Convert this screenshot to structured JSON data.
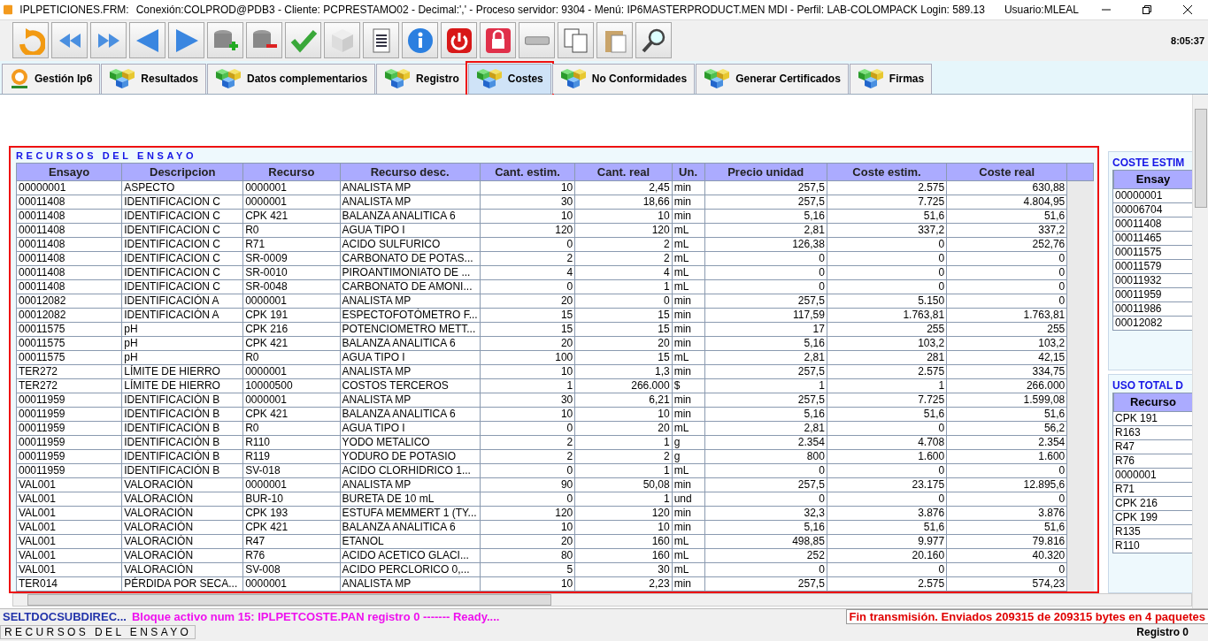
{
  "window": {
    "title": "IPLPETICIONES.FRM:",
    "info": "Conexión:COLPROD@PDB3 - Cliente: PCPRESTAMO02 - Decimal:',' - Proceso servidor: 9304 - Menú: IP6MASTERPRODUCT.MEN MDI - Perfil: LAB-COLOMPACK Login: 589.13",
    "user": "Usuario:MLEAL"
  },
  "toolbar": {
    "buttons": [
      {
        "kind": "refresh"
      },
      {
        "kind": "rewind"
      },
      {
        "kind": "forward"
      },
      {
        "kind": "prev"
      },
      {
        "kind": "next"
      },
      {
        "kind": "db-add"
      },
      {
        "kind": "db-remove"
      },
      {
        "kind": "check"
      },
      {
        "kind": "cube"
      },
      {
        "kind": "document"
      },
      {
        "kind": "info"
      },
      {
        "kind": "power"
      },
      {
        "kind": "lock"
      },
      {
        "kind": "bar"
      },
      {
        "kind": "copy"
      },
      {
        "kind": "paste"
      },
      {
        "kind": "search"
      }
    ],
    "clock": "8:05:37"
  },
  "tabs": [
    {
      "label": "Gestión Ip6",
      "kind": "logo",
      "selected": false,
      "highlighted": false
    },
    {
      "label": "Resultados",
      "kind": "cubes",
      "selected": false,
      "highlighted": false
    },
    {
      "label": "Datos complementarios",
      "kind": "cubes",
      "selected": false,
      "highlighted": false
    },
    {
      "label": "Registro",
      "kind": "cubes",
      "selected": false,
      "highlighted": false
    },
    {
      "label": "Costes",
      "kind": "cubes",
      "selected": true,
      "highlighted": true
    },
    {
      "label": "No Conformidades",
      "kind": "cubes",
      "selected": false,
      "highlighted": false
    },
    {
      "label": "Generar Certificados",
      "kind": "cubes",
      "selected": false,
      "highlighted": false
    },
    {
      "label": "Firmas",
      "kind": "cubes",
      "selected": false,
      "highlighted": false
    }
  ],
  "resources_panel": {
    "title": "RECURSOS DEL ENSAYO",
    "highlighted": true,
    "columns": [
      {
        "label": "Ensayo",
        "kind": "text"
      },
      {
        "label": "Descripcion",
        "kind": "text"
      },
      {
        "label": "Recurso",
        "kind": "text"
      },
      {
        "label": "Recurso desc.",
        "kind": "text"
      },
      {
        "label": "Cant. estim.",
        "kind": "number"
      },
      {
        "label": "Cant. real",
        "kind": "number"
      },
      {
        "label": "Un.",
        "kind": "text"
      },
      {
        "label": "Precio unidad",
        "kind": "number"
      },
      {
        "label": "Coste estim.",
        "kind": "number"
      },
      {
        "label": "Coste real",
        "kind": "number"
      }
    ],
    "rows": [
      [
        "00000001",
        "ASPECTO",
        "0000001",
        "ANALISTA MP",
        "10",
        "2,45",
        "min",
        "257,5",
        "2.575",
        "630,88"
      ],
      [
        "00011408",
        "IDENTIFICACION C",
        "0000001",
        "ANALISTA MP",
        "30",
        "18,66",
        "min",
        "257,5",
        "7.725",
        "4.804,95"
      ],
      [
        "00011408",
        "IDENTIFICACION C",
        "CPK 421",
        "BALANZA ANALITICA 6",
        "10",
        "10",
        "min",
        "5,16",
        "51,6",
        "51,6"
      ],
      [
        "00011408",
        "IDENTIFICACION C",
        "R0",
        "AGUA TIPO I",
        "120",
        "120",
        "mL",
        "2,81",
        "337,2",
        "337,2"
      ],
      [
        "00011408",
        "IDENTIFICACION C",
        "R71",
        "ACIDO SULFURICO",
        "0",
        "2",
        "mL",
        "126,38",
        "0",
        "252,76"
      ],
      [
        "00011408",
        "IDENTIFICACION C",
        "SR-0009",
        "CARBONATO DE POTAS...",
        "2",
        "2",
        "mL",
        "0",
        "0",
        "0"
      ],
      [
        "00011408",
        "IDENTIFICACION C",
        "SR-0010",
        "PIROANTIMONIATO DE ...",
        "4",
        "4",
        "mL",
        "0",
        "0",
        "0"
      ],
      [
        "00011408",
        "IDENTIFICACION C",
        "SR-0048",
        "CARBONATO DE AMONI...",
        "0",
        "1",
        "mL",
        "0",
        "0",
        "0"
      ],
      [
        "00012082",
        "IDENTIFICACIÓN A",
        "0000001",
        "ANALISTA MP",
        "20",
        "0",
        "min",
        "257,5",
        "5.150",
        "0"
      ],
      [
        "00012082",
        "IDENTIFICACIÓN A",
        "CPK 191",
        "ESPECTOFOTÓMETRO F...",
        "15",
        "15",
        "min",
        "117,59",
        "1.763,81",
        "1.763,81"
      ],
      [
        "00011575",
        "pH",
        "CPK 216",
        "POTENCIOMETRO METT...",
        "15",
        "15",
        "min",
        "17",
        "255",
        "255"
      ],
      [
        "00011575",
        "pH",
        "CPK 421",
        "BALANZA ANALITICA 6",
        "20",
        "20",
        "min",
        "5,16",
        "103,2",
        "103,2"
      ],
      [
        "00011575",
        "pH",
        "R0",
        "AGUA TIPO I",
        "100",
        "15",
        "mL",
        "2,81",
        "281",
        "42,15"
      ],
      [
        "TER272",
        "LÍMITE DE HIERRO",
        "0000001",
        "ANALISTA MP",
        "10",
        "1,3",
        "min",
        "257,5",
        "2.575",
        "334,75"
      ],
      [
        "TER272",
        "LÍMITE DE HIERRO",
        "10000500",
        "COSTOS TERCEROS",
        "1",
        "266.000",
        "$",
        "1",
        "1",
        "266.000"
      ],
      [
        "00011959",
        "IDENTIFICACIÓN B",
        "0000001",
        "ANALISTA MP",
        "30",
        "6,21",
        "min",
        "257,5",
        "7.725",
        "1.599,08"
      ],
      [
        "00011959",
        "IDENTIFICACIÓN B",
        "CPK 421",
        "BALANZA ANALITICA 6",
        "10",
        "10",
        "min",
        "5,16",
        "51,6",
        "51,6"
      ],
      [
        "00011959",
        "IDENTIFICACIÓN B",
        "R0",
        "AGUA TIPO I",
        "0",
        "20",
        "mL",
        "2,81",
        "0",
        "56,2"
      ],
      [
        "00011959",
        "IDENTIFICACIÓN B",
        "R110",
        "YODO METALICO",
        "2",
        "1",
        "g",
        "2.354",
        "4.708",
        "2.354"
      ],
      [
        "00011959",
        "IDENTIFICACIÓN B",
        "R119",
        "YODURO DE POTASIO",
        "2",
        "2",
        "g",
        "800",
        "1.600",
        "1.600"
      ],
      [
        "00011959",
        "IDENTIFICACIÓN B",
        "SV-018",
        "ACIDO CLORHIDRICO 1...",
        "0",
        "1",
        "mL",
        "0",
        "0",
        "0"
      ],
      [
        "VAL001",
        "VALORACIÓN",
        "0000001",
        "ANALISTA MP",
        "90",
        "50,08",
        "min",
        "257,5",
        "23.175",
        "12.895,6"
      ],
      [
        "VAL001",
        "VALORACIÓN",
        "BUR-10",
        "BURETA DE 10 mL",
        "0",
        "1",
        "und",
        "0",
        "0",
        "0"
      ],
      [
        "VAL001",
        "VALORACIÓN",
        "CPK 193",
        "ESTUFA MEMMERT 1 (TY...",
        "120",
        "120",
        "min",
        "32,3",
        "3.876",
        "3.876"
      ],
      [
        "VAL001",
        "VALORACIÓN",
        "CPK 421",
        "BALANZA ANALITICA 6",
        "10",
        "10",
        "min",
        "5,16",
        "51,6",
        "51,6"
      ],
      [
        "VAL001",
        "VALORACIÓN",
        "R47",
        "ETANOL",
        "20",
        "160",
        "mL",
        "498,85",
        "9.977",
        "79.816"
      ],
      [
        "VAL001",
        "VALORACIÓN",
        "R76",
        "ACIDO ACETICO GLACI...",
        "80",
        "160",
        "mL",
        "252",
        "20.160",
        "40.320"
      ],
      [
        "VAL001",
        "VALORACIÓN",
        "SV-008",
        "ACIDO PERCLORICO 0,...",
        "5",
        "30",
        "mL",
        "0",
        "0",
        "0"
      ],
      [
        "TER014",
        "PÉRDIDA POR SECA...",
        "0000001",
        "ANALISTA MP",
        "10",
        "2,23",
        "min",
        "257,5",
        "2.575",
        "574,23"
      ]
    ]
  },
  "side_panels": [
    {
      "title": "COSTE ESTIM",
      "column": "Ensay",
      "rows": [
        "00000001",
        "00006704",
        "00011408",
        "00011465",
        "00011575",
        "00011579",
        "00011932",
        "00011959",
        "00011986",
        "00012082"
      ]
    },
    {
      "title": "USO TOTAL D",
      "column": "Recurso",
      "rows": [
        "CPK 191",
        "R163",
        "R47",
        "R76",
        "0000001",
        "R71",
        "CPK 216",
        "CPK 199",
        "R135",
        "R110"
      ]
    }
  ],
  "status_bar": {
    "messages": [
      {
        "text": "SELTDOCSUBDIREC...",
        "kind": "block"
      },
      {
        "text": "Bloque activo num 15: IPLPETCOSTE.PAN  registro 0 ------- Ready....",
        "kind": "info"
      },
      {
        "text": "Fin transmisión. Enviados 209315 de 209315 bytes en 4 paquetes",
        "kind": "error"
      }
    ],
    "section": "RECURSOS DEL ENSAYO",
    "record": "Registro 0"
  }
}
